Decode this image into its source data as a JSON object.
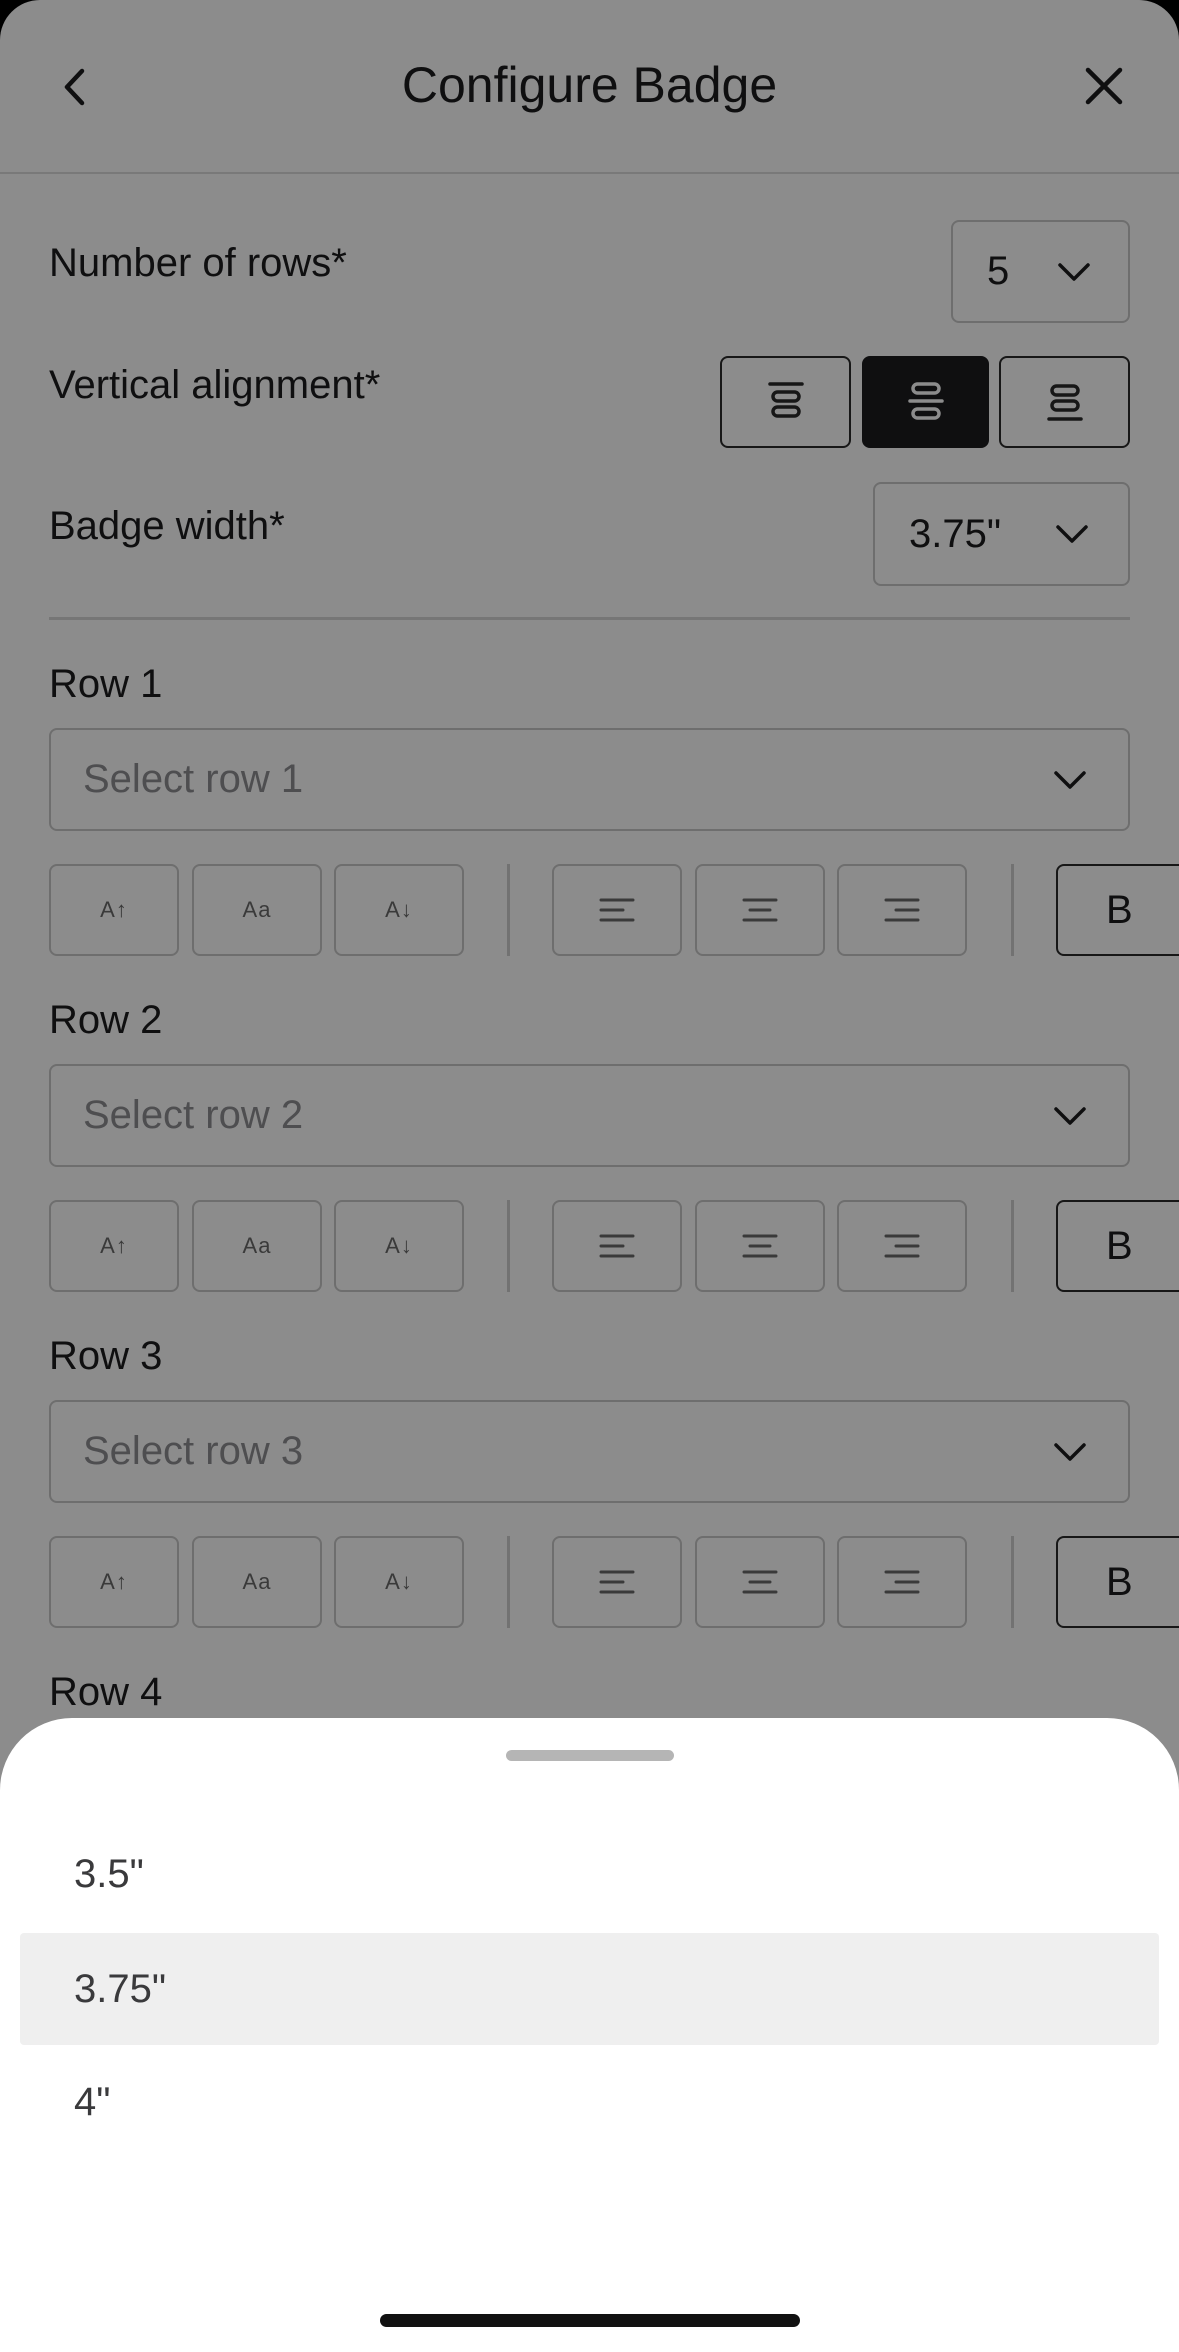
{
  "header": {
    "title": "Configure Badge"
  },
  "settings": {
    "rows_label": "Number of rows*",
    "rows_value": "5",
    "valign_label": "Vertical alignment*",
    "valign_options": [
      "top",
      "center",
      "bottom"
    ],
    "valign_selected": "center",
    "width_label": "Badge width*",
    "width_value": "3.75\""
  },
  "rows": [
    {
      "label": "Row 1",
      "placeholder": "Select row 1"
    },
    {
      "label": "Row 2",
      "placeholder": "Select row 2"
    },
    {
      "label": "Row 3",
      "placeholder": "Select row 3"
    },
    {
      "label": "Row 4"
    }
  ],
  "format_buttons": {
    "size_up": "A↑",
    "size_normal": "Aa",
    "size_down": "A↓",
    "bold": "B"
  },
  "sheet": {
    "options": [
      "3.5\"",
      "3.75\"",
      "4\""
    ],
    "selected": "3.75\""
  },
  "colors": {
    "accent": "#1c1c1e",
    "overlay": "rgba(0,0,0,0.45)",
    "selected_option_bg": "#efefef"
  },
  "icons": [
    "chevron-left-icon",
    "close-icon",
    "chevron-down-icon",
    "align-top-icon",
    "align-middle-icon",
    "align-bottom-icon",
    "text-align-left-icon",
    "text-align-center-icon",
    "text-align-right-icon"
  ]
}
